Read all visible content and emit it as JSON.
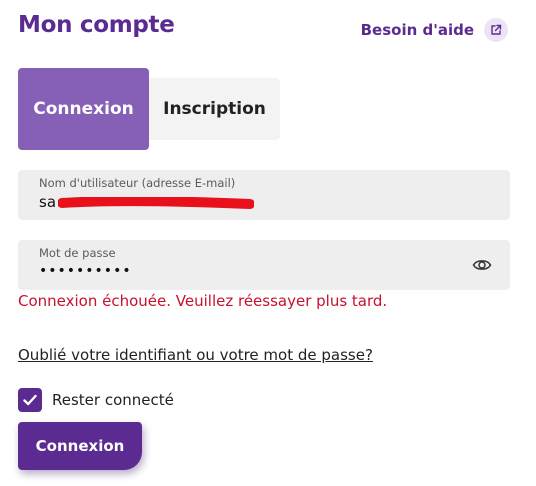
{
  "header": {
    "title": "Mon compte",
    "help_label": "Besoin d'aide",
    "help_icon": "external-link-icon"
  },
  "tabs": [
    {
      "label": "Connexion",
      "active": true
    },
    {
      "label": "Inscription",
      "active": false
    }
  ],
  "form": {
    "username_label": "Nom d'utilisateur (adresse E-mail)",
    "username_value": "sa",
    "password_label": "Mot de passe",
    "password_value": "••••••••••",
    "password_icon": "eye-icon",
    "error_message": "Connexion échouée. Veuillez réessayer plus tard.",
    "forgot_link": "Oublié votre identifiant ou votre mot de passe?",
    "remember_label": "Rester connecté",
    "remember_checked": true,
    "submit_label": "Connexion"
  },
  "colors": {
    "brand": "#5b2b91",
    "tab_active": "#8560b6",
    "error": "#c8102e",
    "field_bg": "#eeeeee",
    "redaction": "#e8101a"
  }
}
